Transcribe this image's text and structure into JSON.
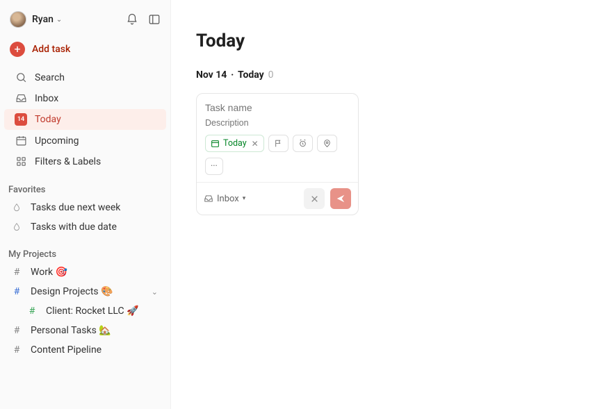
{
  "header": {
    "username": "Ryan"
  },
  "sidebar": {
    "add_task_label": "Add task",
    "nav": {
      "search": "Search",
      "inbox": "Inbox",
      "today": "Today",
      "today_date": "14",
      "upcoming": "Upcoming",
      "filters": "Filters & Labels"
    },
    "favorites_title": "Favorites",
    "favorites": [
      "Tasks due next week",
      "Tasks with due date"
    ],
    "projects_title": "My Projects",
    "projects": {
      "work": "Work 🎯",
      "design": "Design Projects 🎨",
      "rocket": "Client: Rocket LLC 🚀",
      "personal": "Personal Tasks 🏡",
      "content": "Content Pipeline"
    }
  },
  "main": {
    "title": "Today",
    "date_label": "Nov 14",
    "date_separator": "‧",
    "date_suffix": "Today",
    "task_count": "0"
  },
  "task_card": {
    "name_placeholder": "Task name",
    "desc_placeholder": "Description",
    "today_chip": "Today",
    "more_chip": "···",
    "project": "Inbox"
  }
}
